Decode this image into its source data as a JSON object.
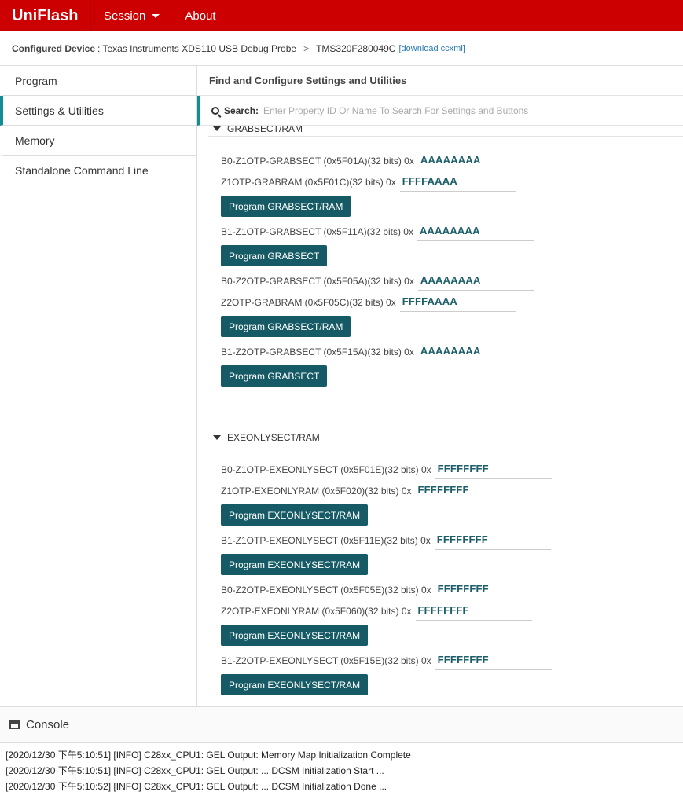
{
  "app": {
    "brand": "UniFlash"
  },
  "menu": {
    "session": "Session",
    "about": "About"
  },
  "breadcrumb": {
    "label": "Configured Device",
    "probe": ": Texas Instruments XDS110 USB Debug Probe",
    "sep": ">",
    "device": "TMS320F280049C",
    "download": "[download ccxml]"
  },
  "sidebar": {
    "items": [
      {
        "label": "Program"
      },
      {
        "label": "Settings & Utilities"
      },
      {
        "label": "Memory"
      },
      {
        "label": "Standalone Command Line"
      }
    ]
  },
  "main": {
    "title": "Find and Configure Settings and Utilities",
    "search": {
      "label": "Search:",
      "placeholder": "Enter Property ID Or Name To Search For Settings and Buttons"
    }
  },
  "sections": {
    "grab": {
      "title": "GRABSECT/RAM",
      "f1": {
        "label": "B0-Z1OTP-GRABSECT (0x5F01A)(32 bits) 0x",
        "value": "AAAAAAAA"
      },
      "f2": {
        "label": "Z1OTP-GRABRAM (0x5F01C)(32 bits) 0x",
        "value": "FFFFAAAA"
      },
      "b1": "Program GRABSECT/RAM",
      "f3": {
        "label": "B1-Z1OTP-GRABSECT (0x5F11A)(32 bits) 0x",
        "value": "AAAAAAAA"
      },
      "b2": "Program GRABSECT",
      "f4": {
        "label": "B0-Z2OTP-GRABSECT (0x5F05A)(32 bits) 0x",
        "value": "AAAAAAAA"
      },
      "f5": {
        "label": "Z2OTP-GRABRAM (0x5F05C)(32 bits) 0x",
        "value": "FFFFAAAA"
      },
      "b3": "Program GRABSECT/RAM",
      "f6": {
        "label": "B1-Z2OTP-GRABSECT (0x5F15A)(32 bits) 0x",
        "value": "AAAAAAAA"
      },
      "b4": "Program GRABSECT"
    },
    "exe": {
      "title": "EXEONLYSECT/RAM",
      "f1": {
        "label": "B0-Z1OTP-EXEONLYSECT (0x5F01E)(32 bits) 0x",
        "value": "FFFFFFFF"
      },
      "f2": {
        "label": "Z1OTP-EXEONLYRAM (0x5F020)(32 bits) 0x",
        "value": "FFFFFFFF"
      },
      "b1": "Program EXEONLYSECT/RAM",
      "f3": {
        "label": "B1-Z1OTP-EXEONLYSECT (0x5F11E)(32 bits) 0x",
        "value": "FFFFFFFF"
      },
      "b2": "Program EXEONLYSECT/RAM",
      "f4": {
        "label": "B0-Z2OTP-EXEONLYSECT (0x5F05E)(32 bits) 0x",
        "value": "FFFFFFFF"
      },
      "f5": {
        "label": "Z2OTP-EXEONLYRAM (0x5F060)(32 bits) 0x",
        "value": "FFFFFFFF"
      },
      "b3": "Program EXEONLYSECT/RAM",
      "f6": {
        "label": "B1-Z2OTP-EXEONLYSECT (0x5F15E)(32 bits) 0x",
        "value": "FFFFFFFF"
      },
      "b4": "Program EXEONLYSECT/RAM"
    }
  },
  "console": {
    "title": "Console",
    "lines": [
      "[2020/12/30 下午5:10:51] [INFO] C28xx_CPU1: GEL Output: Memory Map Initialization Complete",
      "[2020/12/30 下午5:10:51] [INFO] C28xx_CPU1: GEL Output: ... DCSM Initialization Start ...",
      "[2020/12/30 下午5:10:52] [INFO] C28xx_CPU1: GEL Output: ... DCSM Initialization Done ..."
    ]
  }
}
